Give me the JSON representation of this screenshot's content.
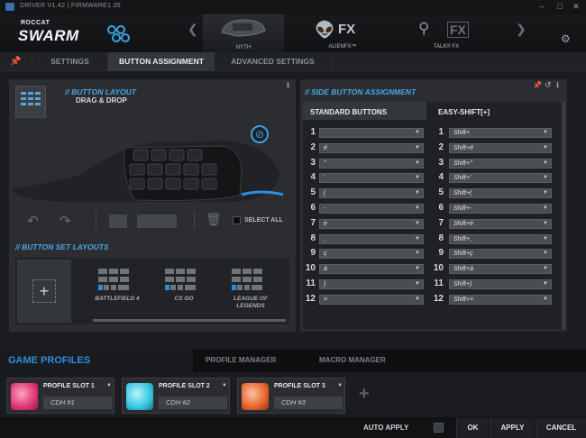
{
  "window": {
    "version": "DRIVER V1.42 | FIRMWARE1.35"
  },
  "logo": {
    "top": "ROCCAT",
    "main": "SWARM"
  },
  "carousel": [
    {
      "label": "NYTH"
    },
    {
      "label": "ALIENFX™",
      "badge": "FX"
    },
    {
      "label": "TALK® FX",
      "badge": "FX"
    }
  ],
  "tabs": {
    "settings": "SETTINGS",
    "button_assignment": "BUTTON ASSIGNMENT",
    "advanced": "ADVANCED SETTINGS"
  },
  "left": {
    "button_layout_title": "// BUTTON LAYOUT",
    "drag_drop": "DRAG & DROP",
    "select_all": "SELECT ALL",
    "button_set_title": "// BUTTON SET LAYOUTS",
    "sets": [
      {
        "name": "BATTLEFIELD 4"
      },
      {
        "name": "CS GO"
      },
      {
        "name": "LEAGUE OF LEGENDS"
      }
    ]
  },
  "right": {
    "title": "// SIDE BUTTON ASSIGNMENT",
    "col_standard": "STANDARD BUTTONS",
    "col_easy": "EASY-SHIFT[+]",
    "rows": [
      {
        "n": "1",
        "std": "",
        "es": "Shift+"
      },
      {
        "n": "2",
        "std": "é",
        "es": "Shift+é"
      },
      {
        "n": "3",
        "std": "\"",
        "es": "Shift+\""
      },
      {
        "n": "4",
        "std": "'",
        "es": "Shift+'"
      },
      {
        "n": "5",
        "std": "(",
        "es": "Shift+("
      },
      {
        "n": "6",
        "std": "-",
        "es": "Shift+-"
      },
      {
        "n": "7",
        "std": "è",
        "es": "Shift+è"
      },
      {
        "n": "8",
        "std": "_",
        "es": "Shift+_"
      },
      {
        "n": "9",
        "std": "ç",
        "es": "Shift+ç"
      },
      {
        "n": "10",
        "std": "à",
        "es": "Shift+à"
      },
      {
        "n": "11",
        "std": ")",
        "es": "Shift+)"
      },
      {
        "n": "12",
        "std": "=",
        "es": "Shift+="
      }
    ]
  },
  "game_profiles": {
    "title": "GAME PROFILES",
    "profile_manager": "PROFILE MANAGER",
    "macro_manager": "MACRO MANAGER",
    "slots": [
      {
        "name": "PROFILE SLOT 1",
        "cdh": "CDH #1",
        "color": "#e0336f"
      },
      {
        "name": "PROFILE SLOT 2",
        "cdh": "CDH #2",
        "color": "#33c7e0"
      },
      {
        "name": "PROFILE SLOT 3",
        "cdh": "CDH #3",
        "color": "#e8612a"
      }
    ]
  },
  "footer": {
    "auto_apply": "AUTO APPLY",
    "ok": "OK",
    "apply": "APPLY",
    "cancel": "CANCEL"
  }
}
